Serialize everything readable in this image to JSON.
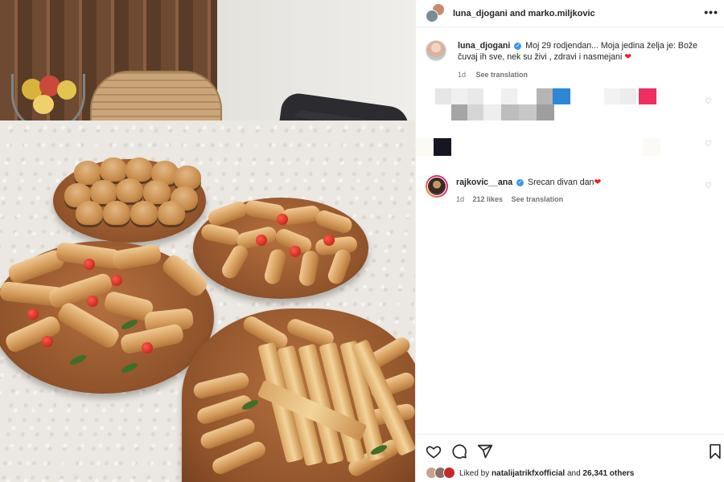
{
  "header": {
    "users_label": "luna_djogani and marko.miljkovic",
    "more_icon": "more-horizontal-icon"
  },
  "caption": {
    "username": "luna_djogani",
    "text_line1": "Moj 29 rodjendan... Moja jedina želja je: Bože",
    "text_line2": "čuvaj ih sve, nek su živi , zdravi i nasmejani",
    "heart": "❤",
    "time": "1d",
    "see_translation": "See translation"
  },
  "comment": {
    "username": "rajkovic__ana",
    "text": "Srecan divan dan",
    "heart": "❤",
    "time": "1d",
    "likes": "212 likes",
    "see_translation": "See translation"
  },
  "likes": {
    "prefix": "Liked by",
    "user": "natalijatrikfxofficial",
    "middle": "and",
    "others": "26,341 others"
  },
  "icons": {
    "verified": "✓",
    "heart_outline": "♡"
  },
  "colors": {
    "verified_blue": "#3897f0",
    "heart_red": "#ed1c24",
    "meta_gray": "#737373"
  }
}
